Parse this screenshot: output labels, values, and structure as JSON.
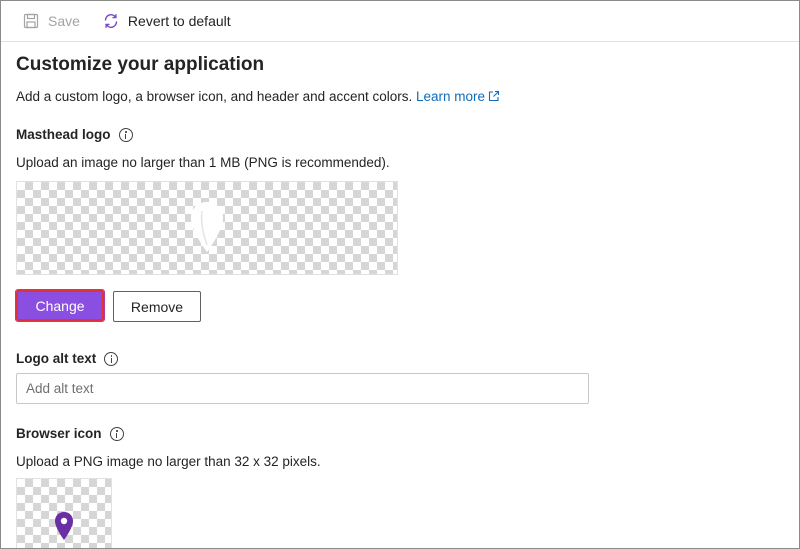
{
  "toolbar": {
    "save_label": "Save",
    "revert_label": "Revert to default"
  },
  "page": {
    "title": "Customize your application",
    "description": "Add a custom logo, a browser icon, and header and accent colors.",
    "learn_more": "Learn more"
  },
  "masthead": {
    "label": "Masthead logo",
    "help": "Upload an image no larger than 1 MB (PNG is recommended).",
    "preview_icon": "map-pin-icon",
    "preview_color": "#ffffff",
    "change_label": "Change",
    "remove_label": "Remove"
  },
  "alt_text": {
    "label": "Logo alt text",
    "value": "",
    "placeholder": "Add alt text"
  },
  "browser_icon": {
    "label": "Browser icon",
    "help": "Upload a PNG image no larger than 32 x 32 pixels.",
    "preview_icon": "map-pin-icon",
    "preview_color": "#6b2fa5"
  },
  "colors": {
    "accent": "#8a4fe0",
    "link": "#0f6cbd",
    "highlight_border": "#e0303a"
  }
}
